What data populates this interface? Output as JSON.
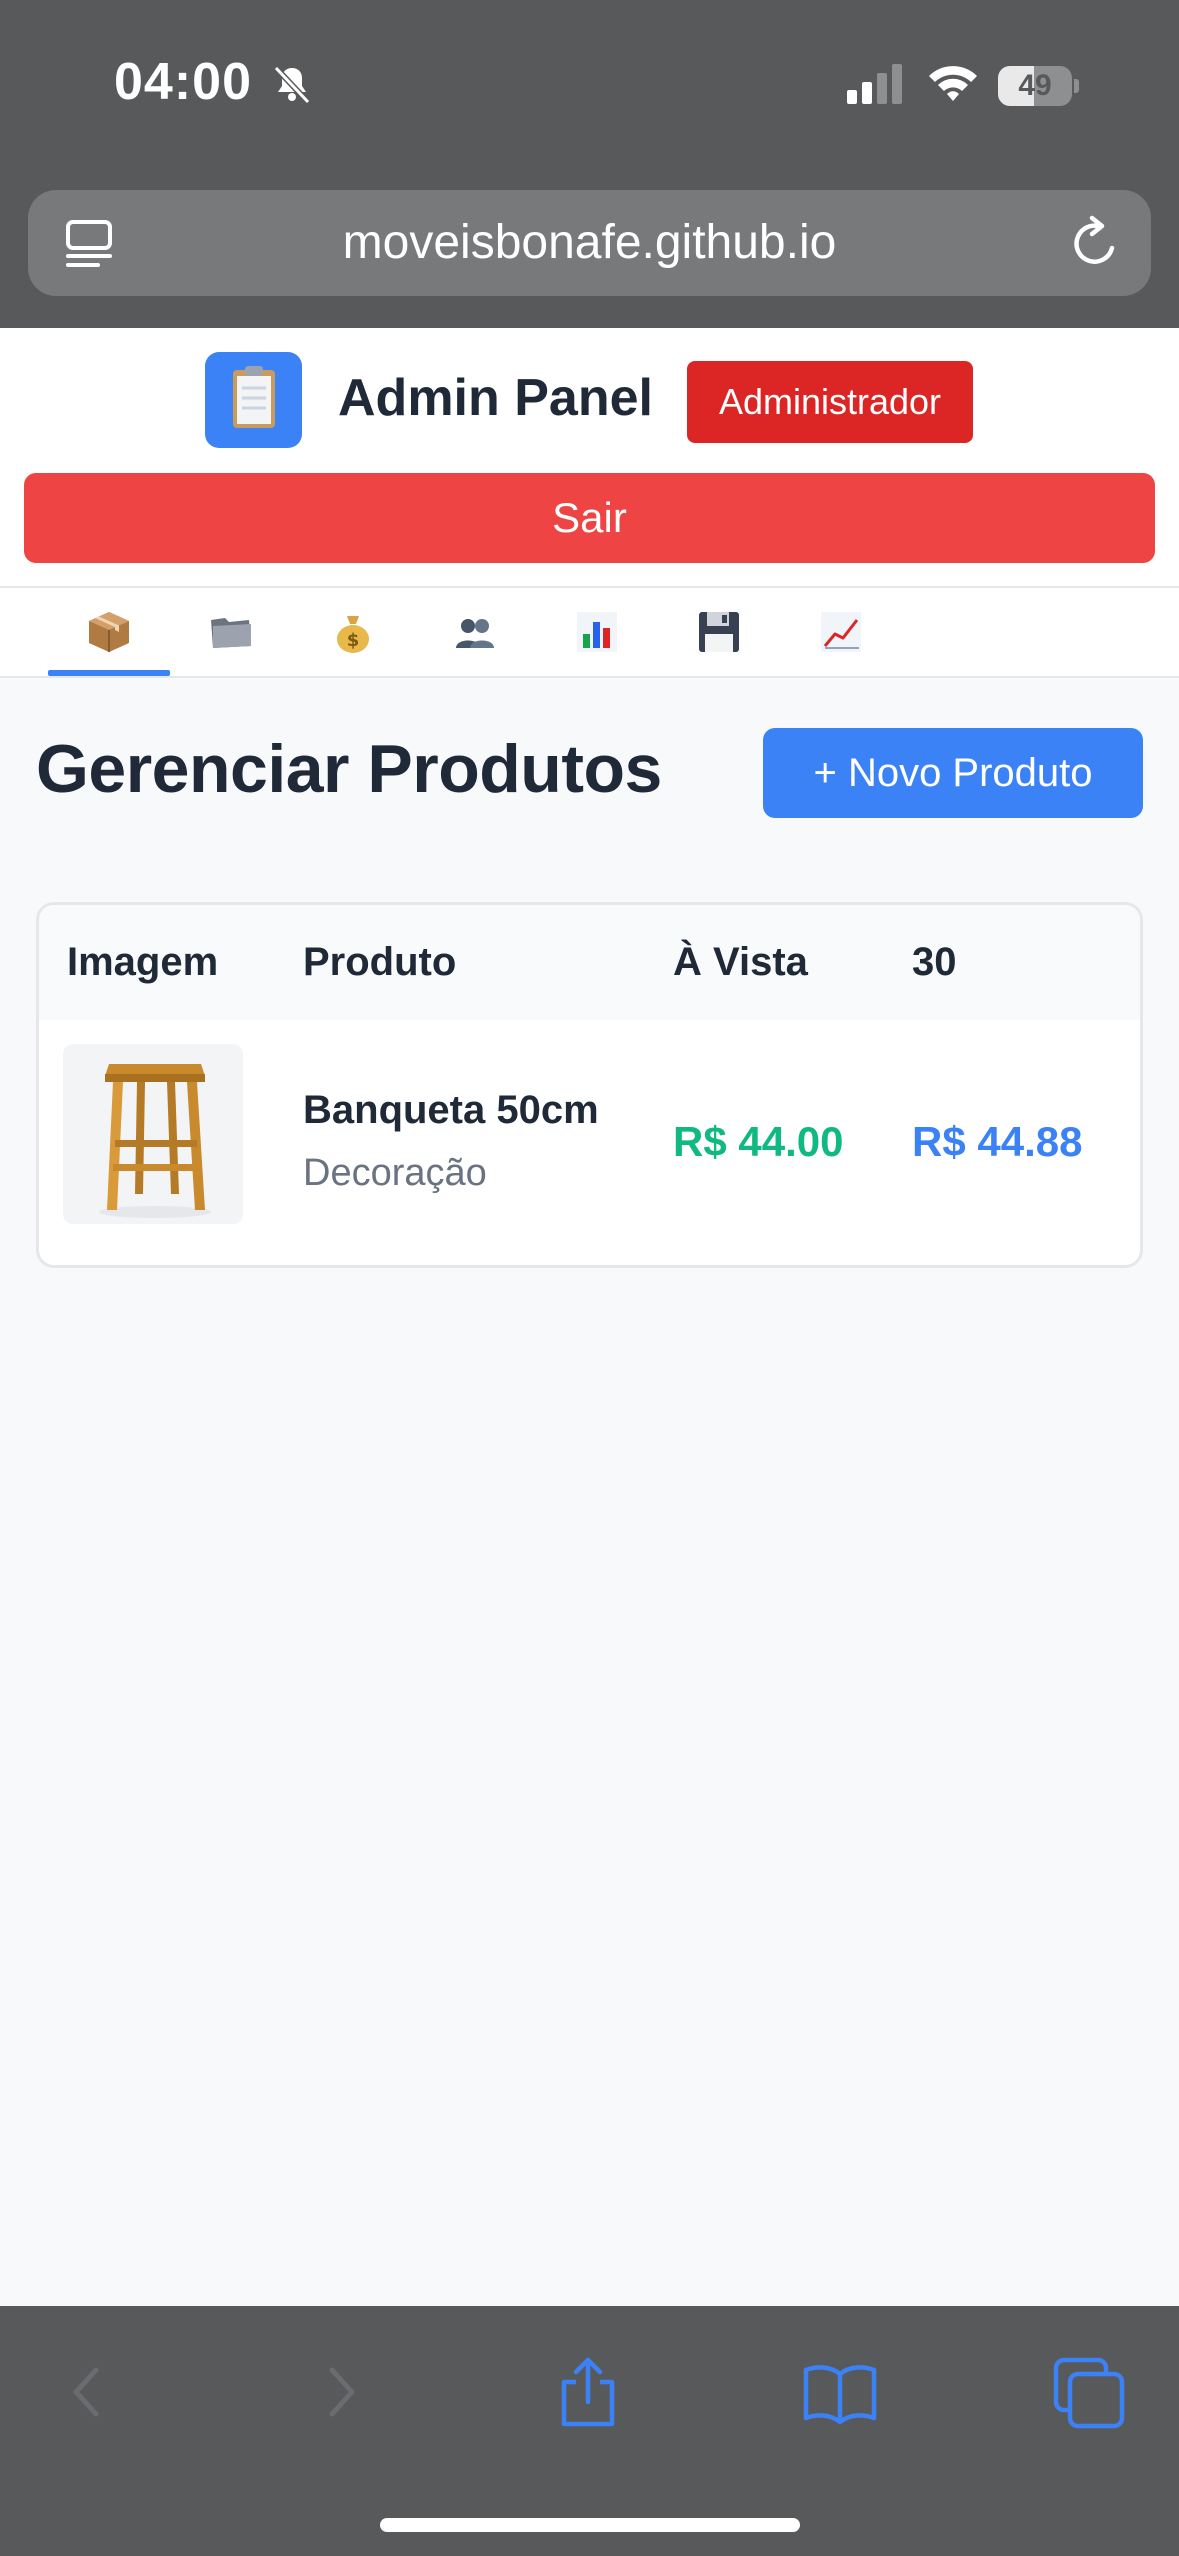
{
  "status_bar": {
    "time": "04:00",
    "battery": "49",
    "battery_level": 0.49
  },
  "browser": {
    "url": "moveisbonafe.github.io"
  },
  "header": {
    "title": "Admin Panel",
    "role_badge": "Administrador",
    "logout_label": "Sair"
  },
  "tabs": [
    {
      "icon": "package-icon",
      "active": true
    },
    {
      "icon": "folder-icon",
      "active": false
    },
    {
      "icon": "money-bag-icon",
      "active": false
    },
    {
      "icon": "users-icon",
      "active": false
    },
    {
      "icon": "bar-chart-icon",
      "active": false
    },
    {
      "icon": "floppy-disk-icon",
      "active": false
    },
    {
      "icon": "trend-chart-icon",
      "active": false
    }
  ],
  "main": {
    "title": "Gerenciar Produtos",
    "new_button": "+ Novo Produto",
    "table": {
      "headers": [
        "Imagem",
        "Produto",
        "À Vista",
        "30"
      ],
      "rows": [
        {
          "image": "stool-image",
          "name": "Banqueta 50cm",
          "category": "Decoração",
          "price_cash": "R$ 44.00",
          "price_30": "R$ 44.88"
        }
      ]
    }
  },
  "colors": {
    "primary": "#3b82f6",
    "danger": "#ef4444",
    "badge": "#dc2626",
    "success": "#10b981",
    "safari_chrome": "#58595b"
  }
}
